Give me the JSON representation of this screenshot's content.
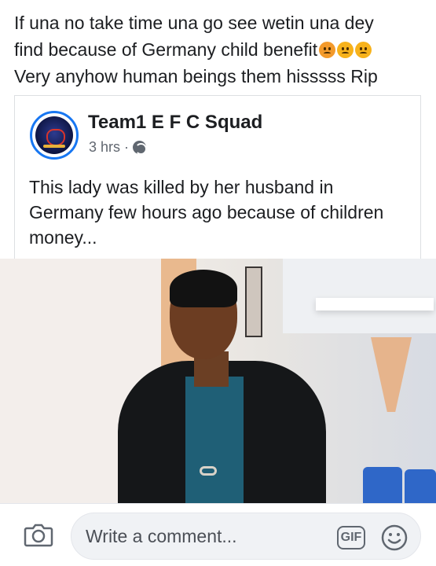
{
  "post": {
    "text_lines": [
      "If una no take time una go see wetin una dey",
      "find because of Germany child benefit",
      "Very anyhow human beings them  hisssss Rip"
    ],
    "emoji_icons": [
      "pouting-face-icon",
      "frowning-face-icon",
      "frowning-face-icon"
    ]
  },
  "shared_post": {
    "page_name": "Team1 E F C Squad",
    "time": "3 hrs",
    "separator": "·",
    "privacy_icon": "globe-icon",
    "text": "This lady was killed by her husband in Germany few hours ago because of children money..."
  },
  "comment_bar": {
    "camera_icon": "camera-icon",
    "placeholder": "Write a comment...",
    "gif_label": "GIF",
    "smiley_icon": "smiley-icon"
  },
  "colors": {
    "accent": "#1877f2",
    "text": "#1c1e21",
    "secondary_text": "#616770",
    "field_bg": "#f0f2f5"
  }
}
